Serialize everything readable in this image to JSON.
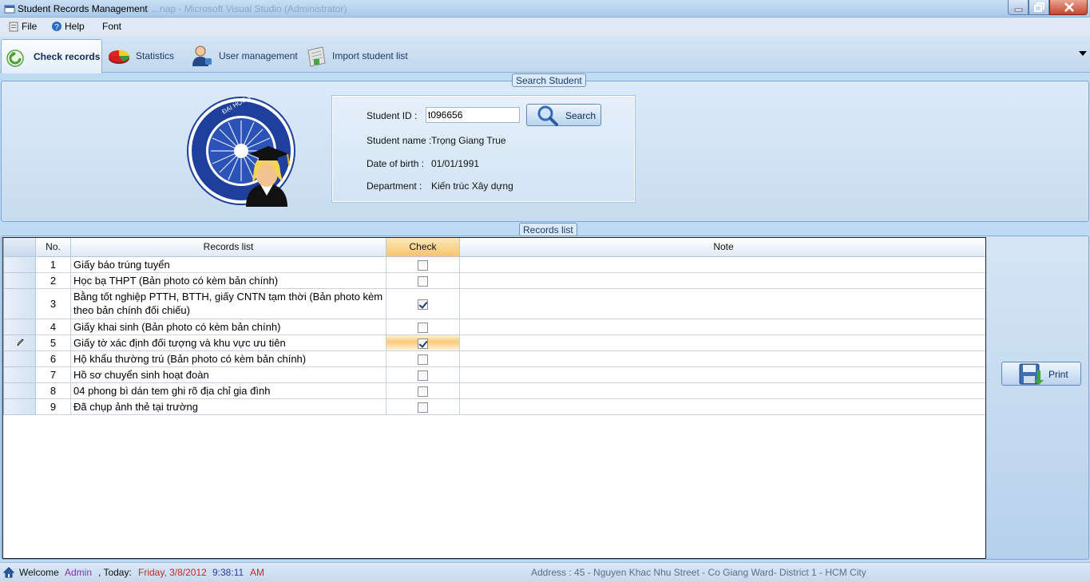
{
  "window": {
    "title": "Student Records Management",
    "ghost_title": "...nap - Microsoft Visual Studio (Administrator)"
  },
  "menu": [
    {
      "label": "File",
      "icon": "file-icon"
    },
    {
      "label": "Help",
      "icon": "help-icon"
    },
    {
      "label": "Font",
      "icon": ""
    }
  ],
  "tabs": [
    {
      "label": "Check records",
      "icon": "back-arrow-icon",
      "active": true
    },
    {
      "label": "Statistics",
      "icon": "pie-chart-icon",
      "active": false
    },
    {
      "label": "User management",
      "icon": "user-icon",
      "active": false
    },
    {
      "label": "Import student list",
      "icon": "import-icon",
      "active": false
    }
  ],
  "search": {
    "caption": "Search Student",
    "student_id_label": "Student ID :",
    "student_id_value": "t096656",
    "search_button": "Search",
    "name_label": "Student name :",
    "name_value": "Trọng Giang True",
    "dob_label": "Date of birth :",
    "dob_value": "01/01/1991",
    "dept_label": "Department :",
    "dept_value": "Kiến trúc Xây dựng"
  },
  "records": {
    "caption": "Records list",
    "columns": {
      "no": "No.",
      "list": "Records list",
      "check": "Check",
      "note": "Note"
    },
    "rows": [
      {
        "no": "1",
        "name": "Giấy báo trúng tuyển",
        "checked": false,
        "note": ""
      },
      {
        "no": "2",
        "name": "Học bạ THPT (Bản photo có kèm bản chính)",
        "checked": false,
        "note": ""
      },
      {
        "no": "3",
        "name": "Bằng tốt nghiệp PTTH, BTTH, giấy CNTN tạm thời (Bản photo kèm theo bản chính đối chiếu)",
        "checked": true,
        "note": ""
      },
      {
        "no": "4",
        "name": "Giấy khai sinh (Bản photo có kèm bản chính)",
        "checked": false,
        "note": ""
      },
      {
        "no": "5",
        "name": "Giấy tờ xác định đối tượng và khu vực ưu tiên",
        "checked": true,
        "note": "",
        "current": true
      },
      {
        "no": "6",
        "name": "Hộ khẩu thường trú (Bản photo có kèm bản chính)",
        "checked": false,
        "note": ""
      },
      {
        "no": "7",
        "name": "Hồ sơ chuyển sinh hoạt đoàn",
        "checked": false,
        "note": ""
      },
      {
        "no": "8",
        "name": "04 phong bì dán tem ghi rõ địa chỉ gia đình",
        "checked": false,
        "note": ""
      },
      {
        "no": "9",
        "name": "Đã chụp ảnh thẻ tại trường",
        "checked": false,
        "note": ""
      }
    ],
    "print_button": "Print"
  },
  "status": {
    "welcome": "Welcome",
    "user": "Admin",
    "today_label": ", Today:",
    "date": "Friday, 3/8/2012",
    "time": "9:38:11",
    "ampm": "AM",
    "address": "Address : 45 - Nguyen Khac Nhu Street - Co Giang Ward- District 1 - HCM City"
  },
  "colors": {
    "accent": "#1c3a66",
    "user_color": "#8a2fa8",
    "date_color": "#c0282e",
    "time_color": "#2b3fa8",
    "address_color": "#5a6f86"
  }
}
